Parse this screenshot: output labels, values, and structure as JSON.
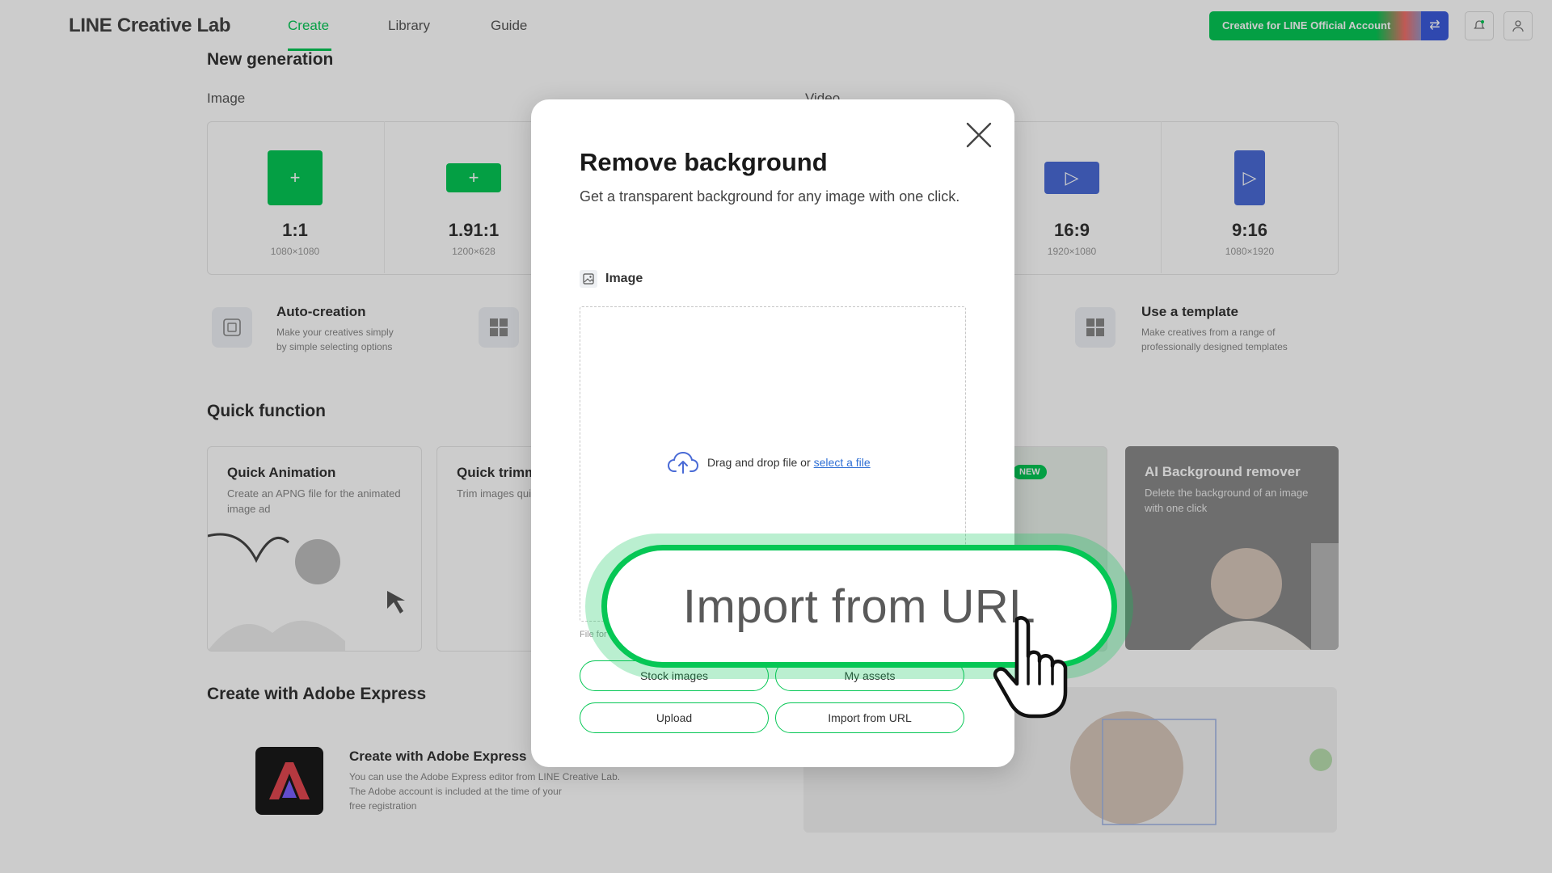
{
  "app": {
    "logo": "LINE Creative Lab",
    "nav": [
      "Create",
      "Library",
      "Guide"
    ],
    "account_button": "Creative for LINE Official Account"
  },
  "new_generation": {
    "title": "New generation",
    "image_label": "Image",
    "video_label": "Video",
    "image_ratios": [
      {
        "label": "1:1",
        "size": "1080×1080"
      },
      {
        "label": "1.91:1",
        "size": "1200×628"
      }
    ],
    "video_ratios": [
      {
        "label": "16:9",
        "size": "1920×1080"
      },
      {
        "label": "9:16",
        "size": "1080×1920"
      }
    ],
    "features": [
      {
        "title": "Auto-creation",
        "desc_line1": "Make your creatives simply",
        "desc_line2": "by simple selecting options"
      },
      {
        "title": "Use a template",
        "desc_line1": "Make creatives from a range of",
        "desc_line2": "professionally designed templates"
      }
    ]
  },
  "quick_function": {
    "title": "Quick function",
    "cards": [
      {
        "title": "Quick Animation",
        "desc": "Create an APNG file for the animated image ad"
      },
      {
        "title": "Quick trimming",
        "desc": "Trim images quickly"
      },
      {
        "title": "AI Background remover",
        "desc": "Delete the background of an image with one click",
        "badge": "NEW"
      }
    ]
  },
  "adobe": {
    "title": "Create with Adobe Express",
    "card_title": "Create with Adobe Express",
    "card_desc_line1": "You can use the Adobe Express editor from LINE Creative Lab.",
    "card_desc_line2": "The Adobe account is included at the time of your",
    "card_desc_line3": "free registration"
  },
  "modal": {
    "title": "Remove background",
    "description": "Get a transparent background for any image with one click.",
    "field_label": "Image",
    "drop_text": "Drag and drop file or",
    "select_link": "select a file",
    "file_note": "File for",
    "buttons": {
      "stock_images": "Stock images",
      "my_assets": "My assets",
      "upload": "Upload",
      "import_url": "Import from URL"
    }
  },
  "callout": {
    "label": "Import from URL"
  },
  "colors": {
    "brand_green": "#06c755",
    "link_blue": "#2f6fd4",
    "video_blue": "#4a6bd6"
  }
}
